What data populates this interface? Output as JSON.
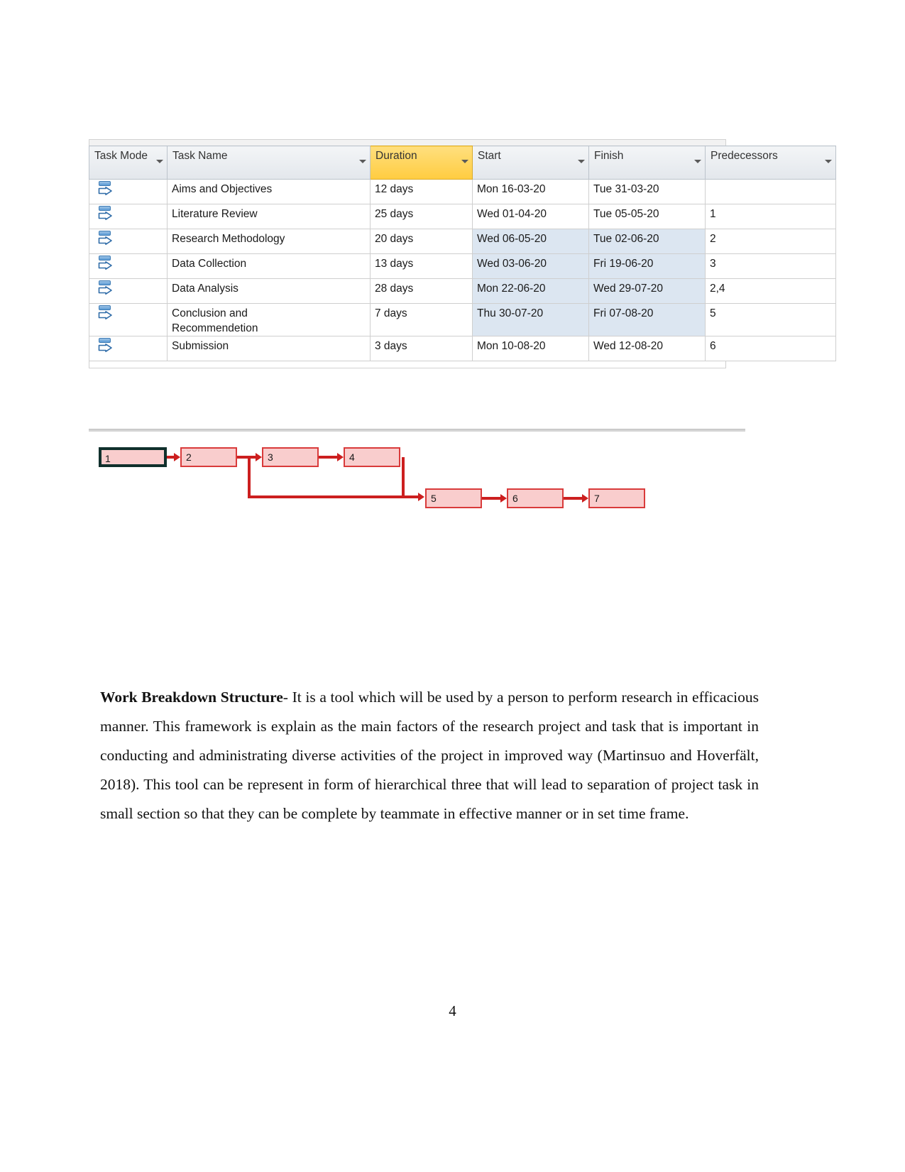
{
  "task_table": {
    "columns": [
      {
        "key": "task_mode",
        "label": "Task Mode",
        "highlight": false
      },
      {
        "key": "task_name",
        "label": "Task Name",
        "highlight": false
      },
      {
        "key": "duration",
        "label": "Duration",
        "highlight": true
      },
      {
        "key": "start",
        "label": "Start",
        "highlight": false
      },
      {
        "key": "finish",
        "label": "Finish",
        "highlight": false
      },
      {
        "key": "predecessors",
        "label": "Predecessors",
        "highlight": false
      }
    ],
    "rows": [
      {
        "id": 1,
        "task_name": "Aims and Objectives",
        "duration": "12 days",
        "start": "Mon 16-03-20",
        "finish": "Tue 31-03-20",
        "predecessors": "",
        "selected": false
      },
      {
        "id": 2,
        "task_name": "Literature Review",
        "duration": "25 days",
        "start": "Wed 01-04-20",
        "finish": "Tue 05-05-20",
        "predecessors": "1",
        "selected": false
      },
      {
        "id": 3,
        "task_name": "Research Methodology",
        "duration": "20 days",
        "start": "Wed 06-05-20",
        "finish": "Tue 02-06-20",
        "predecessors": "2",
        "selected": true
      },
      {
        "id": 4,
        "task_name": "Data Collection",
        "duration": "13 days",
        "start": "Wed 03-06-20",
        "finish": "Fri 19-06-20",
        "predecessors": "3",
        "selected": true
      },
      {
        "id": 5,
        "task_name": "Data Analysis",
        "duration": "28 days",
        "start": "Mon 22-06-20",
        "finish": "Wed 29-07-20",
        "predecessors": "2,4",
        "selected": true
      },
      {
        "id": 6,
        "task_name": "Conclusion and\nRecommendetion",
        "duration": "7 days",
        "start": "Thu 30-07-20",
        "finish": "Fri 07-08-20",
        "predecessors": "5",
        "selected": true
      },
      {
        "id": 7,
        "task_name": "Submission",
        "duration": "3 days",
        "start": "Mon 10-08-20",
        "finish": "Wed 12-08-20",
        "predecessors": "6",
        "selected": false
      }
    ],
    "icons": {
      "sort_caret": "chevron-down-icon",
      "task_mode_row": "manual-schedule-icon"
    },
    "colors": {
      "duration_header": "#ffd966",
      "header_background": "#eceff2",
      "selected_cell": "#dce6f1"
    }
  },
  "network_diagram": {
    "nodes": [
      {
        "id": "n1",
        "label": "1",
        "selected": true
      },
      {
        "id": "n2",
        "label": "2",
        "selected": false
      },
      {
        "id": "n3",
        "label": "3",
        "selected": false
      },
      {
        "id": "n4",
        "label": "4",
        "selected": false
      },
      {
        "id": "n5",
        "label": "5",
        "selected": false
      },
      {
        "id": "n6",
        "label": "6",
        "selected": false
      },
      {
        "id": "n7",
        "label": "7",
        "selected": false
      }
    ],
    "links": [
      {
        "from": "n1",
        "to": "n2"
      },
      {
        "from": "n2",
        "to": "n3"
      },
      {
        "from": "n3",
        "to": "n4"
      },
      {
        "from": "n4",
        "to": "n5"
      },
      {
        "from": "n2",
        "to": "n5"
      },
      {
        "from": "n5",
        "to": "n6"
      },
      {
        "from": "n6",
        "to": "n7"
      }
    ],
    "colors": {
      "node_fill": "#f9cdcd",
      "node_border": "#d93b3b",
      "selected_border": "#10302c",
      "connector": "#cc1f1f"
    }
  },
  "body": {
    "wbs": {
      "lead": "Work Breakdown Structure",
      "text": "- It is a tool which will be used by a person to perform research in efficacious manner. This framework is explain as the main factors of the research project and task that is important in conducting and administrating diverse activities of the project in improved way (Martinsuo and Hoverfält, 2018). This tool can be represent in form of hierarchical three that will lead to separation of project task in small section so that they can be complete by teammate in effective manner or in set time frame."
    }
  },
  "footer": {
    "page_number": "4"
  }
}
